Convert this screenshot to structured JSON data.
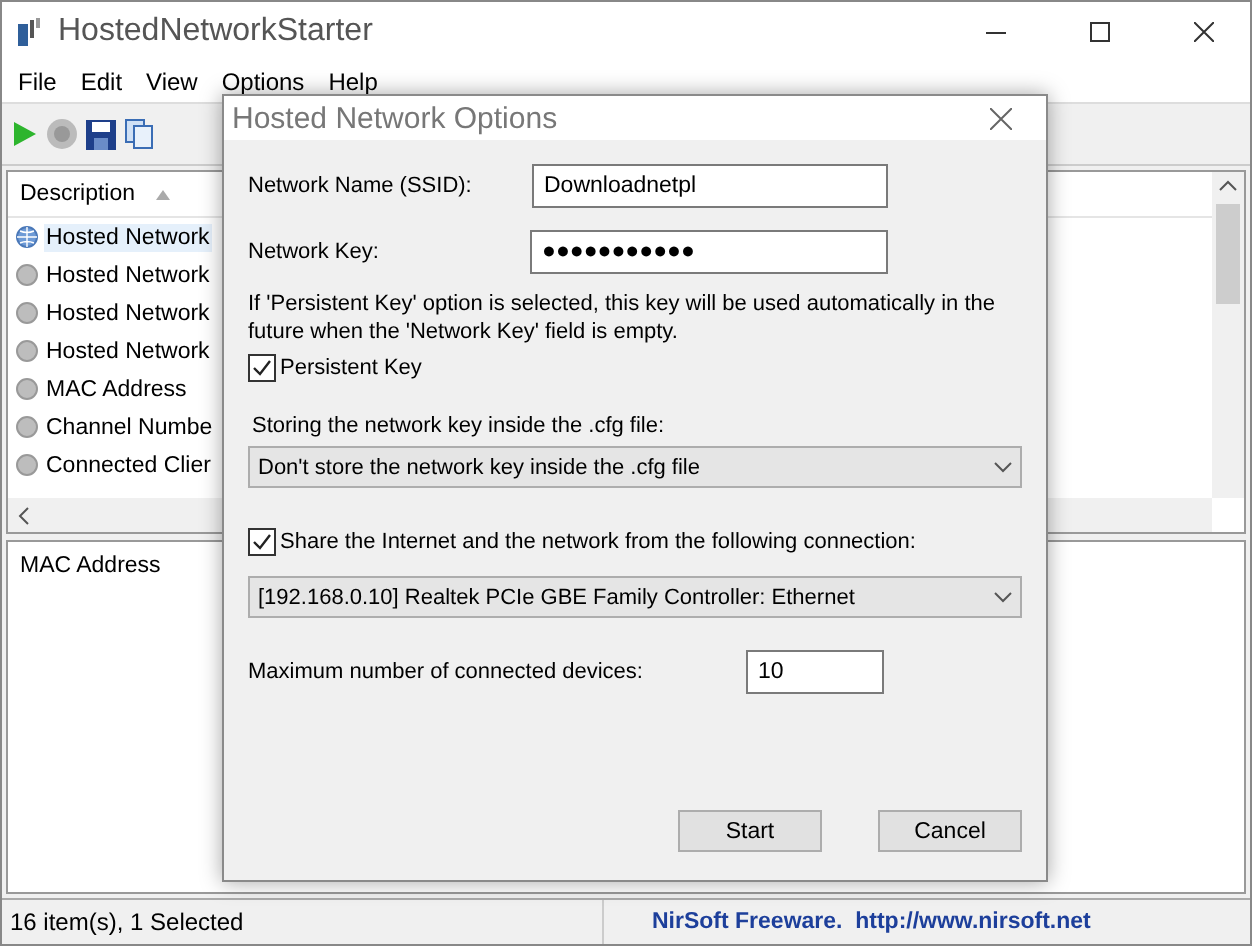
{
  "window": {
    "title": "HostedNetworkStarter"
  },
  "menu": [
    "File",
    "Edit",
    "View",
    "Options",
    "Help"
  ],
  "list": {
    "column": "Description",
    "items": [
      {
        "label": "Hosted Network",
        "selected": true
      },
      {
        "label": "Hosted Network",
        "selected": false
      },
      {
        "label": "Hosted Network",
        "selected": false
      },
      {
        "label": "Hosted Network",
        "selected": false
      },
      {
        "label": "MAC Address",
        "selected": false
      },
      {
        "label": "Channel Numbe",
        "selected": false
      },
      {
        "label": "Connected Clier",
        "selected": false
      }
    ]
  },
  "details": {
    "column": "MAC Address"
  },
  "status_bar": {
    "count": "16 item(s), 1 Selected",
    "credit": "NirSoft Freeware.  http://www.nirsoft.net"
  },
  "dialog": {
    "title": "Hosted Network Options",
    "ssid_label": "Network Name (SSID):",
    "ssid_value": "Downloadnetpl",
    "key_label": "Network Key:",
    "key_value": "●●●●●●●●●●●",
    "note": "If 'Persistent Key' option is selected, this key will be used automatically in the future when the 'Network Key' field is empty.",
    "persistent": {
      "label": "Persistent Key",
      "checked": true
    },
    "store_label": "Storing the network key inside the .cfg file:",
    "store_value": "Don't store the network key inside the .cfg file",
    "share": {
      "label": "Share the Internet and the network from the following connection:",
      "checked": true
    },
    "connection_value": "[192.168.0.10]  Realtek PCIe GBE Family Controller: Ethernet",
    "max_label": "Maximum number of connected devices:",
    "max_value": "10",
    "buttons": [
      "Start",
      "Cancel"
    ]
  }
}
